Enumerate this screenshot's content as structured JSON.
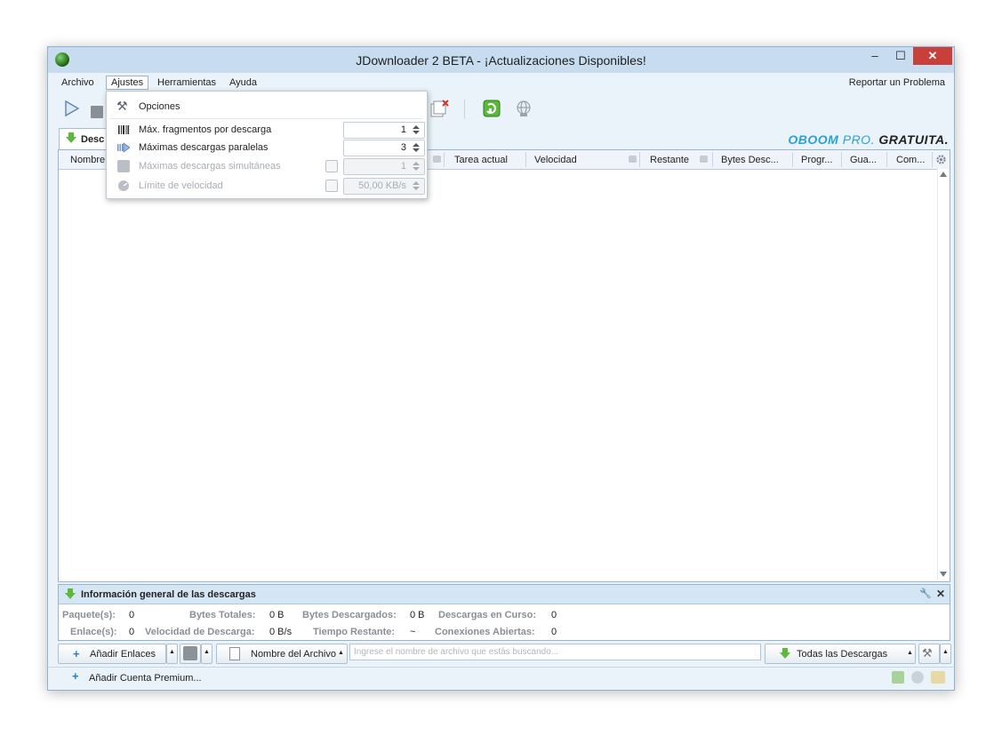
{
  "window": {
    "title": "JDownloader 2 BETA - ¡Actualizaciones Disponibles!",
    "controls": {
      "minimize": "–",
      "maximize": "☐",
      "close": "✕"
    }
  },
  "menubar": {
    "items": [
      "Archivo",
      "Ajustes",
      "Herramientas",
      "Ayuda"
    ],
    "active": "Ajustes",
    "report": "Reportar un Problema"
  },
  "ajustes_menu": {
    "options_label": "Opciones",
    "items": [
      {
        "label": "Máx. fragmentos por descarga",
        "value": "1",
        "enabled": true
      },
      {
        "label": "Máximas descargas paralelas",
        "value": "3",
        "enabled": true
      },
      {
        "label": "Máximas descargas simultáneas",
        "value": "1",
        "enabled": false
      },
      {
        "label": "Límite de velocidad",
        "value": "50,00 KB/s",
        "enabled": false
      }
    ]
  },
  "tabs": {
    "downloads_tab": "Desc"
  },
  "logo": {
    "brand": "OBOOM",
    "pro": "PRO.",
    "free": "GRATUITA."
  },
  "table": {
    "columns": [
      "Nombre",
      "Tarea actual",
      "Velocidad",
      "Restante",
      "Bytes Desc...",
      "Progr...",
      "Gua...",
      "Com..."
    ]
  },
  "info": {
    "title": "Información general de las descargas",
    "paquetes_label": "Paquete(s):",
    "paquetes": "0",
    "bytes_totales_label": "Bytes Totales:",
    "bytes_totales": "0 B",
    "bytes_descargados_label": "Bytes Descargados:",
    "bytes_descargados": "0 B",
    "descargas_en_curso_label": "Descargas en Curso:",
    "descargas_en_curso": "0",
    "enlaces_label": "Enlace(s):",
    "enlaces": "0",
    "velocidad_label": "Velocidad de Descarga:",
    "velocidad": "0 B/s",
    "tiempo_label": "Tiempo Restante:",
    "tiempo": "~",
    "conexiones_label": "Conexiones Abiertas:",
    "conexiones": "0"
  },
  "bottombar": {
    "add_links": "Añadir Enlaces",
    "filename_sort": "Nombre del Archivo",
    "search_placeholder": "Ingrese el nombre de archivo que estás buscando...",
    "all_downloads": "Todas las Descargas"
  },
  "statusbar": {
    "add_premium": "Añadir Cuenta Premium..."
  },
  "colors": {
    "accent": "#2aa0d8",
    "close": "#c8403a",
    "green": "#5cb83a"
  }
}
